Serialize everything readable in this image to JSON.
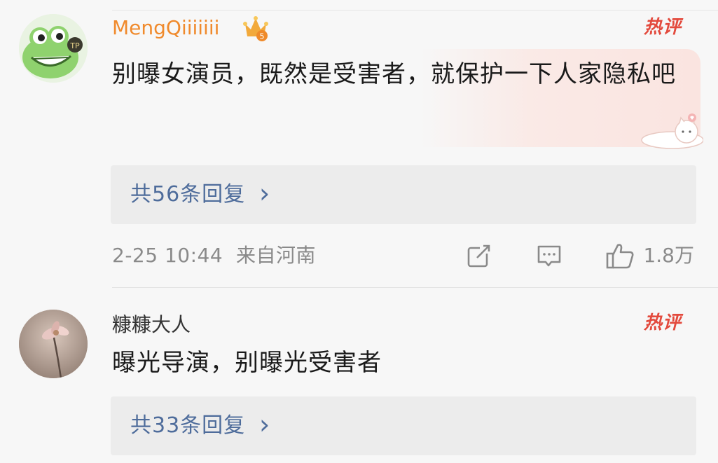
{
  "comments": [
    {
      "username": "MengQiiiiiii",
      "username_color": "#f08a2c",
      "vip_badge_level": "5",
      "hot_label": "热评",
      "text": "别曝女演员，既然是受害者，就保护一下人家隐私吧",
      "replies": "共56条回复",
      "reply_chevron": "›",
      "timestamp": "2-25 10:44",
      "location": "来自河南",
      "likes": "1.8万"
    },
    {
      "username": "糠糠大人",
      "username_color": "#333333",
      "hot_label": "热评",
      "text": "曝光导演，别曝光受害者",
      "replies": "共33条回复",
      "reply_chevron": "›"
    }
  ],
  "colors": {
    "hot": "#e34a3d",
    "link": "#4e6c9b",
    "meta": "#8a8a8a"
  },
  "icons": [
    "share-icon",
    "comment-icon",
    "like-icon",
    "vip-crown-icon",
    "chevron-right-icon"
  ]
}
